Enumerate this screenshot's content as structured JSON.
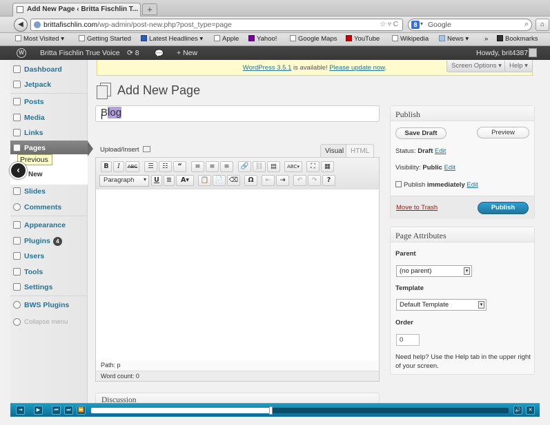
{
  "browser": {
    "tab_title": "Add New Page ‹ Britta Fischlin T...",
    "new_tab": "+",
    "url_host": "brittafischlin.com",
    "url_path": "/wp-admin/post-new.php?post_type=page",
    "search_engine": "Google",
    "bookmarks": [
      {
        "label": "Most Visited ▾"
      },
      {
        "label": "Getting Started"
      },
      {
        "label": "Latest Headlines ▾"
      },
      {
        "label": "Apple"
      },
      {
        "label": "Yahoo!"
      },
      {
        "label": "Google Maps"
      },
      {
        "label": "YouTube"
      },
      {
        "label": "Wikipedia"
      },
      {
        "label": "News ▾"
      },
      {
        "label": "»"
      },
      {
        "label": "Bookmarks"
      }
    ]
  },
  "adminbar": {
    "site_name": "Britta Fischlin True Voice",
    "updates_count": "8",
    "new_label": "New",
    "howdy": "Howdy, brit4387"
  },
  "sidebar": {
    "items": [
      {
        "label": "Dashboard"
      },
      {
        "label": "Jetpack"
      },
      {
        "label": "Posts"
      },
      {
        "label": "Media"
      },
      {
        "label": "Links"
      },
      {
        "label": "Pages"
      },
      {
        "label": "Slides"
      },
      {
        "label": "Comments"
      },
      {
        "label": "Appearance"
      },
      {
        "label": "Plugins",
        "badge": "4"
      },
      {
        "label": "Users"
      },
      {
        "label": "Tools"
      },
      {
        "label": "Settings"
      },
      {
        "label": "BWS Plugins"
      },
      {
        "label": "Collapse menu"
      }
    ],
    "submenu_new": "New"
  },
  "overlay": {
    "previous_tooltip": "Previous"
  },
  "notice": {
    "version_link": "WordPress 3.5.1",
    "middle": " is available! ",
    "update_link": "Please update now",
    "end": "."
  },
  "screen_options": "Screen Options ▾",
  "help": "Help ▾",
  "page_title": "Add New Page",
  "title_input": {
    "prefix": "B",
    "selected": "log"
  },
  "editor": {
    "upload_insert": "Upload/Insert",
    "tab_visual": "Visual",
    "tab_html": "HTML",
    "format_select": "Paragraph",
    "path": "Path: p",
    "word_count": "Word count: 0"
  },
  "discussion": "Discussion",
  "publish": {
    "heading": "Publish",
    "save_draft": "Save Draft",
    "preview": "Preview",
    "status_label": "Status: ",
    "status_value": "Draft",
    "visibility_label": "Visibility: ",
    "visibility_value": "Public",
    "publish_label": "Publish ",
    "publish_value": "immediately",
    "edit": "Edit",
    "move_to_trash": "Move to Trash",
    "publish_button": "Publish"
  },
  "attributes": {
    "heading": "Page Attributes",
    "parent_label": "Parent",
    "parent_value": "(no parent)",
    "template_label": "Template",
    "template_value": "Default Template",
    "order_label": "Order",
    "order_value": "0",
    "help_text": "Need help? Use the Help tab in the upper right of your screen."
  },
  "player": {
    "progress": 0.43
  },
  "colors": {
    "accent": "#21759b",
    "publish": "#2e9fd2",
    "trash": "#bc0b0b",
    "player": "#1a9ac4"
  }
}
